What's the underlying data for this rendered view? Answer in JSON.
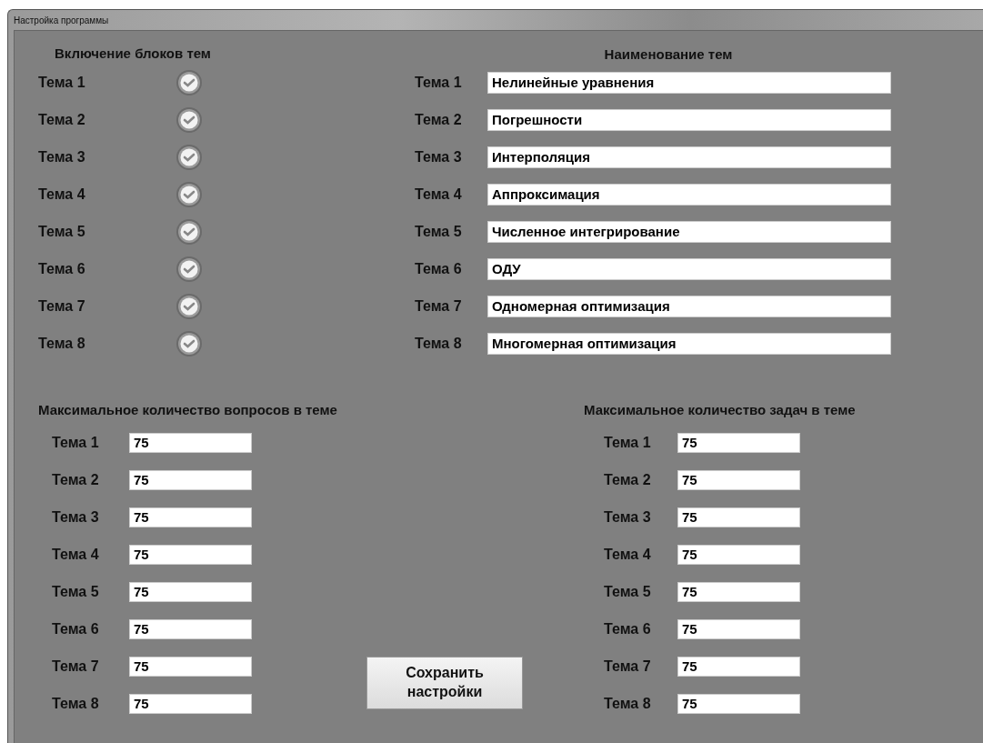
{
  "window": {
    "title": "Настройка программы"
  },
  "enable_blocks": {
    "heading": "Включение блоков тем",
    "items": [
      {
        "label": "Тема 1",
        "checked": true
      },
      {
        "label": "Тема 2",
        "checked": true
      },
      {
        "label": "Тема 3",
        "checked": true
      },
      {
        "label": "Тема 4",
        "checked": true
      },
      {
        "label": "Тема 5",
        "checked": true
      },
      {
        "label": "Тема 6",
        "checked": true
      },
      {
        "label": "Тема 7",
        "checked": true
      },
      {
        "label": "Тема 8",
        "checked": true
      }
    ]
  },
  "topic_names": {
    "heading": "Наименование тем",
    "items": [
      {
        "label": "Тема 1",
        "value": "Нелинейные уравнения"
      },
      {
        "label": "Тема 2",
        "value": "Погрешности"
      },
      {
        "label": "Тема 3",
        "value": "Интерполяция"
      },
      {
        "label": "Тема 4",
        "value": "Аппроксимация"
      },
      {
        "label": "Тема 5",
        "value": "Численное интегрирование"
      },
      {
        "label": "Тема 6",
        "value": "ОДУ"
      },
      {
        "label": "Тема 7",
        "value": "Одномерная оптимизация"
      },
      {
        "label": "Тема 8",
        "value": "Многомерная оптимизация"
      }
    ]
  },
  "max_questions": {
    "heading": "Максимальное количество вопросов в теме",
    "items": [
      {
        "label": "Тема 1",
        "value": "75"
      },
      {
        "label": "Тема 2",
        "value": "75"
      },
      {
        "label": "Тема 3",
        "value": "75"
      },
      {
        "label": "Тема 4",
        "value": "75"
      },
      {
        "label": "Тема 5",
        "value": "75"
      },
      {
        "label": "Тема 6",
        "value": "75"
      },
      {
        "label": "Тема 7",
        "value": "75"
      },
      {
        "label": "Тема 8",
        "value": "75"
      }
    ]
  },
  "max_tasks": {
    "heading": "Максимальное количество задач в теме",
    "items": [
      {
        "label": "Тема 1",
        "value": "75"
      },
      {
        "label": "Тема 2",
        "value": "75"
      },
      {
        "label": "Тема 3",
        "value": "75"
      },
      {
        "label": "Тема 4",
        "value": "75"
      },
      {
        "label": "Тема 5",
        "value": "75"
      },
      {
        "label": "Тема 6",
        "value": "75"
      },
      {
        "label": "Тема 7",
        "value": "75"
      },
      {
        "label": "Тема 8",
        "value": "75"
      }
    ]
  },
  "save_button": "Сохранить настройки"
}
